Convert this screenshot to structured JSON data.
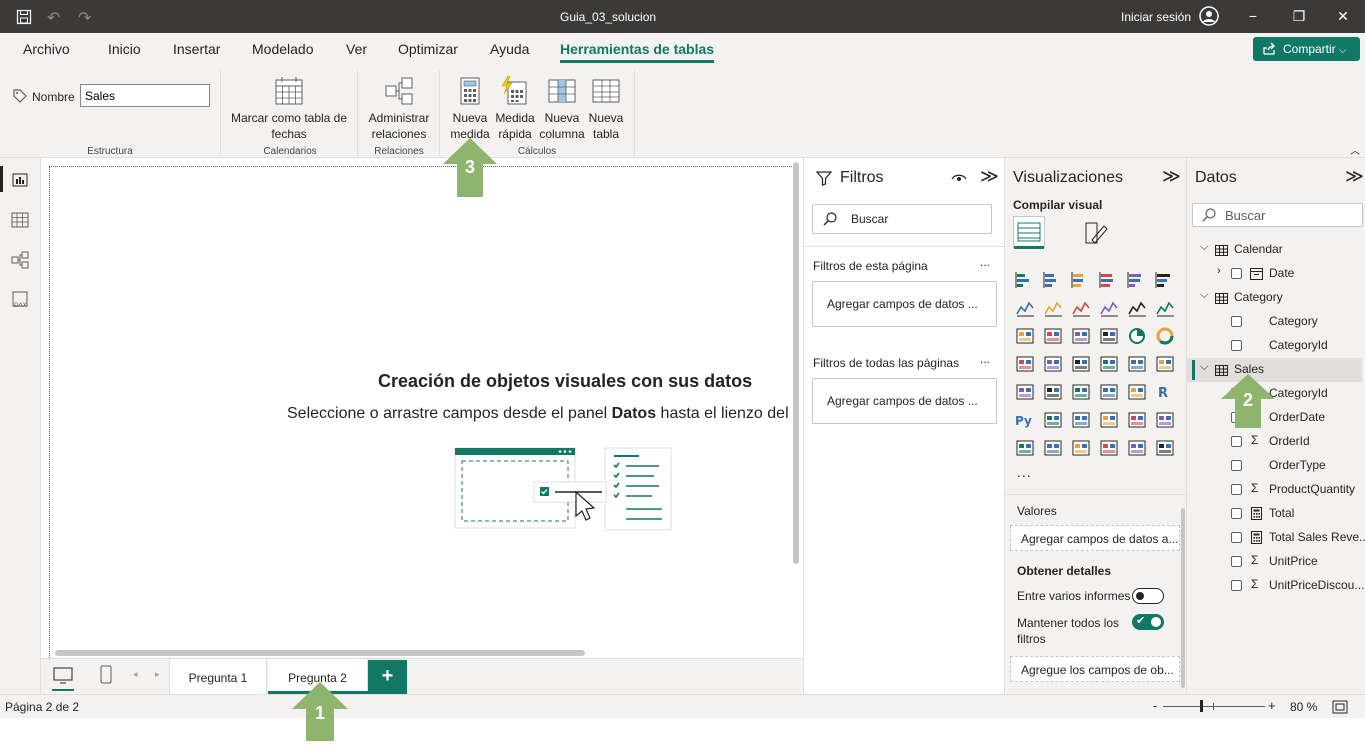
{
  "titlebar": {
    "doc_title": "Guia_03_solucion",
    "signin": "Iniciar sesión"
  },
  "tabs": [
    "Archivo",
    "Inicio",
    "Insertar",
    "Modelado",
    "Ver",
    "Optimizar",
    "Ayuda",
    "Herramientas de tablas"
  ],
  "share": "Compartir",
  "ribbon": {
    "name_label": "Nombre",
    "name_value": "Sales",
    "group_structure": "Estructura",
    "mark_date_line1": "Marcar como tabla de",
    "mark_date_line2": "fechas",
    "group_calendars": "Calendarios",
    "manage_rel_line1": "Administrar",
    "manage_rel_line2": "relaciones",
    "group_relations": "Relaciones",
    "new_measure_line1": "Nueva",
    "new_measure_line2": "medida",
    "quick_measure_line1": "Medida",
    "quick_measure_line2": "rápida",
    "new_column_line1": "Nueva",
    "new_column_line2": "columna",
    "new_table_line1": "Nueva",
    "new_table_line2": "tabla",
    "group_calc": "Cálculos"
  },
  "canvas": {
    "heading": "Creación de objetos visuales con sus datos",
    "sub_pre": "Seleccione o arrastre campos desde el panel ",
    "sub_bold": "Datos",
    "sub_post": " hasta el lienzo del ir"
  },
  "pages": {
    "tab1": "Pregunta 1",
    "tab2": "Pregunta 2",
    "add": "+"
  },
  "filters": {
    "title": "Filtros",
    "search": "Buscar",
    "this_page": "Filtros de esta página",
    "all_pages": "Filtros de todas las páginas",
    "add_fields": "Agregar campos de datos ...",
    "more": "..."
  },
  "viz": {
    "title": "Visualizaciones",
    "build": "Compilar visual",
    "values": "Valores",
    "values_well": "Agregar campos de datos a...",
    "drill": "Obtener detalles",
    "cross_report": "Entre varios informes",
    "keep_filters_l1": "Mantener todos los",
    "keep_filters_l2": "filtros",
    "drill_well": "Agregue los campos de ob...",
    "more": "..."
  },
  "data": {
    "title": "Datos",
    "search": "Buscar",
    "tables": [
      {
        "name": "Calendar",
        "fields": [
          "Date"
        ]
      },
      {
        "name": "Category",
        "fields": [
          "Category",
          "CategoryId"
        ]
      },
      {
        "name": "Sales",
        "fields": [
          "CategoryId",
          "OrderDate",
          "OrderId",
          "OrderType",
          "ProductQuantity",
          "Total",
          "Total Sales Reve...",
          "UnitPrice",
          "UnitPriceDiscou..."
        ]
      }
    ]
  },
  "status": {
    "page": "Página 2 de 2",
    "zoom": "80 %",
    "minus": "-",
    "plus": "+"
  },
  "callouts": [
    "1",
    "2",
    "3"
  ],
  "colors": {
    "accent": "#117865",
    "callout": "#8fb46e"
  }
}
